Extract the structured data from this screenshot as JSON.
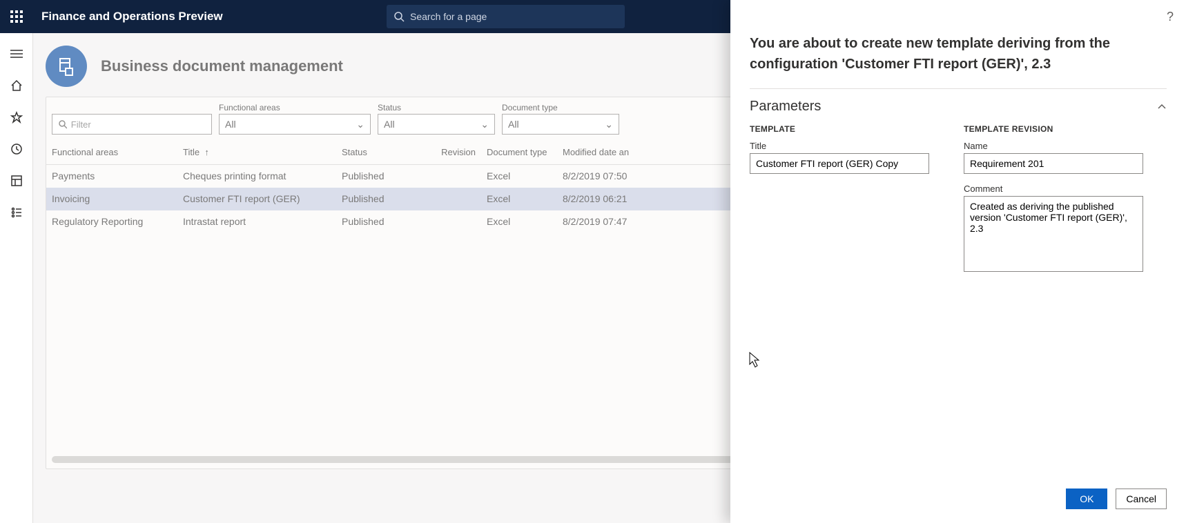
{
  "header": {
    "app_title": "Finance and Operations Preview",
    "search_placeholder": "Search for a page"
  },
  "page": {
    "title": "Business document management"
  },
  "filters": {
    "filter_placeholder": "Filter",
    "functional_areas_label": "Functional areas",
    "functional_areas_value": "All",
    "status_label": "Status",
    "status_value": "All",
    "doctype_label": "Document type",
    "doctype_value": "All"
  },
  "grid": {
    "headers": {
      "functional_areas": "Functional areas",
      "title": "Title",
      "status": "Status",
      "revision": "Revision",
      "document_type": "Document type",
      "modified": "Modified date an"
    },
    "rows": [
      {
        "fa": "Payments",
        "title": "Cheques printing format",
        "status": "Published",
        "revision": "",
        "doctype": "Excel",
        "modified": "8/2/2019 07:50"
      },
      {
        "fa": "Invoicing",
        "title": "Customer FTI report (GER)",
        "status": "Published",
        "revision": "",
        "doctype": "Excel",
        "modified": "8/2/2019 06:21"
      },
      {
        "fa": "Regulatory Reporting",
        "title": "Intrastat report",
        "status": "Published",
        "revision": "",
        "doctype": "Excel",
        "modified": "8/2/2019 07:47"
      }
    ]
  },
  "panel": {
    "title": "You are about to create new template deriving from the configuration 'Customer FTI report (GER)', 2.3",
    "section": "Parameters",
    "template_heading": "TEMPLATE",
    "revision_heading": "TEMPLATE REVISION",
    "title_label": "Title",
    "title_value": "Customer FTI report (GER) Copy",
    "name_label": "Name",
    "name_value": "Requirement 201",
    "comment_label": "Comment",
    "comment_value": "Created as deriving the published version 'Customer FTI report (GER)', 2.3",
    "ok": "OK",
    "cancel": "Cancel"
  }
}
